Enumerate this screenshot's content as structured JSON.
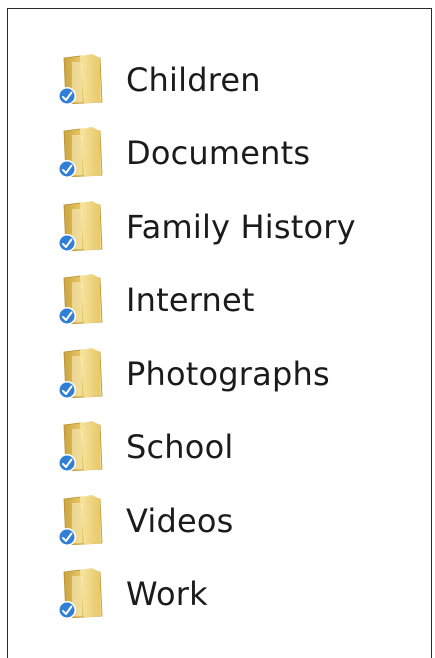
{
  "folders": [
    {
      "label": "Children",
      "icon": "shared-folder-icon"
    },
    {
      "label": "Documents",
      "icon": "shared-folder-icon"
    },
    {
      "label": "Family History",
      "icon": "shared-folder-icon"
    },
    {
      "label": "Internet",
      "icon": "shared-folder-icon"
    },
    {
      "label": "Photographs",
      "icon": "shared-folder-icon"
    },
    {
      "label": "School",
      "icon": "shared-folder-icon"
    },
    {
      "label": "Videos",
      "icon": "shared-folder-icon"
    },
    {
      "label": "Work",
      "icon": "shared-folder-icon"
    }
  ],
  "colors": {
    "folder_body": "#e8c766",
    "folder_front": "#f3dd8e",
    "folder_shadow": "#c9a440",
    "badge_blue": "#2f7fd6",
    "border": "#2a2a2a"
  }
}
